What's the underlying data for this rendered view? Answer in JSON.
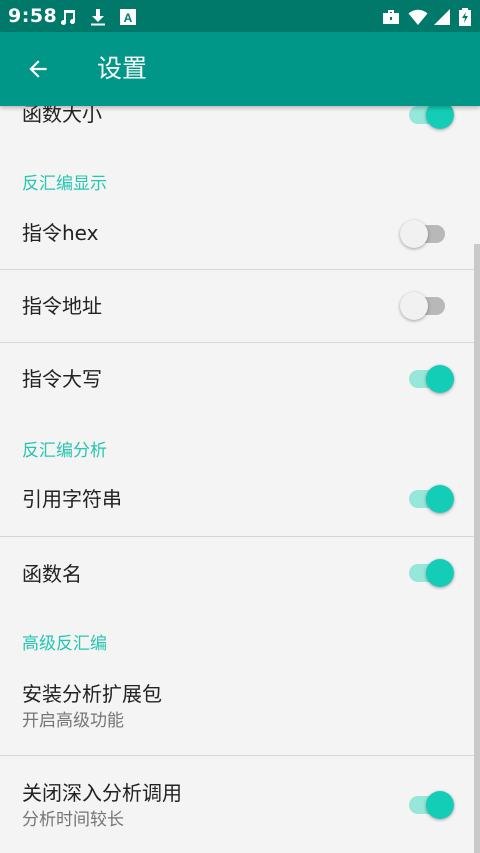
{
  "status_bar": {
    "time": "9:58",
    "left_icons": [
      "music-note-icon",
      "download-icon",
      "font-a-icon"
    ],
    "right_icons": [
      "briefcase-icon",
      "wifi-icon",
      "signal-icon",
      "battery-charging-icon"
    ]
  },
  "app_bar": {
    "title": "设置",
    "back_icon": "arrow-back-icon",
    "color": "#009688"
  },
  "colors": {
    "accent": "#14cdb6",
    "category_text": "#26c6b0",
    "status_bar": "#00796b"
  },
  "settings": {
    "partial_item": {
      "title": "函数大小",
      "enabled": true
    },
    "category_disasm_display": "反汇编显示",
    "instruction_hex": {
      "title": "指令hex",
      "enabled": false
    },
    "instruction_address": {
      "title": "指令地址",
      "enabled": false
    },
    "instruction_uppercase": {
      "title": "指令大写",
      "enabled": true
    },
    "category_disasm_analysis": "反汇编分析",
    "reference_strings": {
      "title": "引用字符串",
      "enabled": true
    },
    "function_names": {
      "title": "函数名",
      "enabled": true
    },
    "category_advanced": "高级反汇编",
    "install_extension": {
      "title": "安装分析扩展包",
      "summary": "开启高级功能"
    },
    "disable_deep_analysis": {
      "title": "关闭深入分析调用",
      "summary": "分析时间较长",
      "enabled": true
    }
  }
}
